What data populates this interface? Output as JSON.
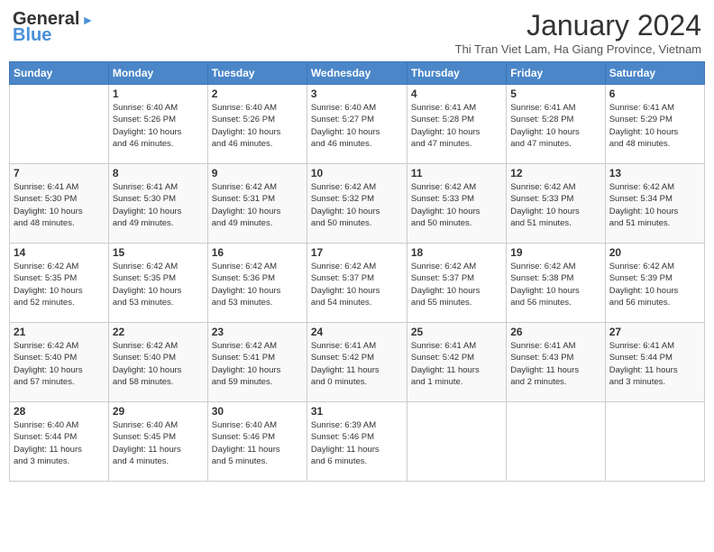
{
  "header": {
    "logo_line1": "General",
    "logo_line2": "Blue",
    "month_title": "January 2024",
    "subtitle": "Thi Tran Viet Lam, Ha Giang Province, Vietnam"
  },
  "days_of_week": [
    "Sunday",
    "Monday",
    "Tuesday",
    "Wednesday",
    "Thursday",
    "Friday",
    "Saturday"
  ],
  "weeks": [
    [
      {
        "day": "",
        "info": ""
      },
      {
        "day": "1",
        "info": "Sunrise: 6:40 AM\nSunset: 5:26 PM\nDaylight: 10 hours\nand 46 minutes."
      },
      {
        "day": "2",
        "info": "Sunrise: 6:40 AM\nSunset: 5:26 PM\nDaylight: 10 hours\nand 46 minutes."
      },
      {
        "day": "3",
        "info": "Sunrise: 6:40 AM\nSunset: 5:27 PM\nDaylight: 10 hours\nand 46 minutes."
      },
      {
        "day": "4",
        "info": "Sunrise: 6:41 AM\nSunset: 5:28 PM\nDaylight: 10 hours\nand 47 minutes."
      },
      {
        "day": "5",
        "info": "Sunrise: 6:41 AM\nSunset: 5:28 PM\nDaylight: 10 hours\nand 47 minutes."
      },
      {
        "day": "6",
        "info": "Sunrise: 6:41 AM\nSunset: 5:29 PM\nDaylight: 10 hours\nand 48 minutes."
      }
    ],
    [
      {
        "day": "7",
        "info": "Sunrise: 6:41 AM\nSunset: 5:30 PM\nDaylight: 10 hours\nand 48 minutes."
      },
      {
        "day": "8",
        "info": "Sunrise: 6:41 AM\nSunset: 5:30 PM\nDaylight: 10 hours\nand 49 minutes."
      },
      {
        "day": "9",
        "info": "Sunrise: 6:42 AM\nSunset: 5:31 PM\nDaylight: 10 hours\nand 49 minutes."
      },
      {
        "day": "10",
        "info": "Sunrise: 6:42 AM\nSunset: 5:32 PM\nDaylight: 10 hours\nand 50 minutes."
      },
      {
        "day": "11",
        "info": "Sunrise: 6:42 AM\nSunset: 5:33 PM\nDaylight: 10 hours\nand 50 minutes."
      },
      {
        "day": "12",
        "info": "Sunrise: 6:42 AM\nSunset: 5:33 PM\nDaylight: 10 hours\nand 51 minutes."
      },
      {
        "day": "13",
        "info": "Sunrise: 6:42 AM\nSunset: 5:34 PM\nDaylight: 10 hours\nand 51 minutes."
      }
    ],
    [
      {
        "day": "14",
        "info": "Sunrise: 6:42 AM\nSunset: 5:35 PM\nDaylight: 10 hours\nand 52 minutes."
      },
      {
        "day": "15",
        "info": "Sunrise: 6:42 AM\nSunset: 5:35 PM\nDaylight: 10 hours\nand 53 minutes."
      },
      {
        "day": "16",
        "info": "Sunrise: 6:42 AM\nSunset: 5:36 PM\nDaylight: 10 hours\nand 53 minutes."
      },
      {
        "day": "17",
        "info": "Sunrise: 6:42 AM\nSunset: 5:37 PM\nDaylight: 10 hours\nand 54 minutes."
      },
      {
        "day": "18",
        "info": "Sunrise: 6:42 AM\nSunset: 5:37 PM\nDaylight: 10 hours\nand 55 minutes."
      },
      {
        "day": "19",
        "info": "Sunrise: 6:42 AM\nSunset: 5:38 PM\nDaylight: 10 hours\nand 56 minutes."
      },
      {
        "day": "20",
        "info": "Sunrise: 6:42 AM\nSunset: 5:39 PM\nDaylight: 10 hours\nand 56 minutes."
      }
    ],
    [
      {
        "day": "21",
        "info": "Sunrise: 6:42 AM\nSunset: 5:40 PM\nDaylight: 10 hours\nand 57 minutes."
      },
      {
        "day": "22",
        "info": "Sunrise: 6:42 AM\nSunset: 5:40 PM\nDaylight: 10 hours\nand 58 minutes."
      },
      {
        "day": "23",
        "info": "Sunrise: 6:42 AM\nSunset: 5:41 PM\nDaylight: 10 hours\nand 59 minutes."
      },
      {
        "day": "24",
        "info": "Sunrise: 6:41 AM\nSunset: 5:42 PM\nDaylight: 11 hours\nand 0 minutes."
      },
      {
        "day": "25",
        "info": "Sunrise: 6:41 AM\nSunset: 5:42 PM\nDaylight: 11 hours\nand 1 minute."
      },
      {
        "day": "26",
        "info": "Sunrise: 6:41 AM\nSunset: 5:43 PM\nDaylight: 11 hours\nand 2 minutes."
      },
      {
        "day": "27",
        "info": "Sunrise: 6:41 AM\nSunset: 5:44 PM\nDaylight: 11 hours\nand 3 minutes."
      }
    ],
    [
      {
        "day": "28",
        "info": "Sunrise: 6:40 AM\nSunset: 5:44 PM\nDaylight: 11 hours\nand 3 minutes."
      },
      {
        "day": "29",
        "info": "Sunrise: 6:40 AM\nSunset: 5:45 PM\nDaylight: 11 hours\nand 4 minutes."
      },
      {
        "day": "30",
        "info": "Sunrise: 6:40 AM\nSunset: 5:46 PM\nDaylight: 11 hours\nand 5 minutes."
      },
      {
        "day": "31",
        "info": "Sunrise: 6:39 AM\nSunset: 5:46 PM\nDaylight: 11 hours\nand 6 minutes."
      },
      {
        "day": "",
        "info": ""
      },
      {
        "day": "",
        "info": ""
      },
      {
        "day": "",
        "info": ""
      }
    ]
  ]
}
